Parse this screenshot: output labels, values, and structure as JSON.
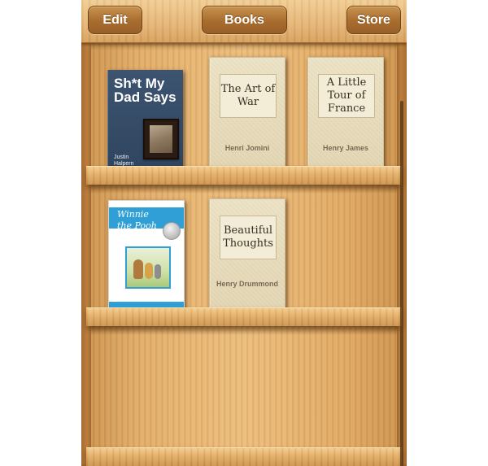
{
  "toolbar": {
    "edit_label": "Edit",
    "books_label": "Books",
    "store_label": "Store"
  },
  "shelves": [
    {
      "books": [
        {
          "title": "Sh*t My Dad Says",
          "author": "Justin Halpern",
          "style": "photo-cover"
        },
        {
          "title": "The Art of War",
          "author": "Henri Jomini",
          "style": "plain"
        },
        {
          "title": "A Little Tour of France",
          "author": "Henry James",
          "style": "plain"
        }
      ]
    },
    {
      "books": [
        {
          "title": "Winnie the Pooh",
          "author": "",
          "style": "illustrated"
        },
        {
          "title": "Beautiful Thoughts",
          "author": "Henry Drummond",
          "style": "plain"
        }
      ]
    },
    {
      "books": []
    }
  ],
  "colors": {
    "wood_light": "#ecbd7c",
    "wood_dark": "#c98f4a",
    "button": "#a86d2e",
    "pooh_blue": "#2f9fd6",
    "shit_cover": "#3d5470"
  }
}
